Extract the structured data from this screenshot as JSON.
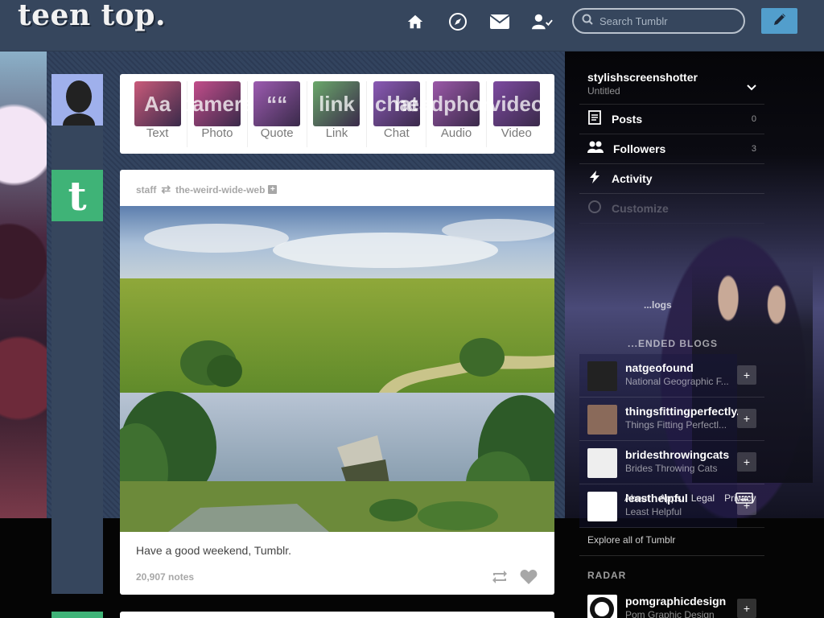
{
  "header": {
    "logo": "teen top.",
    "search_placeholder": "Search Tumblr",
    "nav_icons": [
      "home-icon",
      "compass-icon",
      "mail-icon",
      "account-icon"
    ],
    "compose_icon": "pencil-icon"
  },
  "post_types": [
    {
      "label": "Text",
      "icon": "Aa",
      "color": "#c95a7a"
    },
    {
      "label": "Photo",
      "icon": "camera",
      "color": "#c24d8a"
    },
    {
      "label": "Quote",
      "icon": "““",
      "color": "#9c5bb0"
    },
    {
      "label": "Link",
      "icon": "link",
      "color": "#6aa86a"
    },
    {
      "label": "Chat",
      "icon": "chat",
      "color": "#8a5ab5"
    },
    {
      "label": "Audio",
      "icon": "headphones",
      "color": "#9b58a8"
    },
    {
      "label": "Video",
      "icon": "video",
      "color": "#7d4aa0"
    }
  ],
  "post": {
    "author": "staff",
    "reblogged_from": "the-weird-wide-web",
    "caption": "Have a good weekend, Tumblr.",
    "notes": "20,907 notes"
  },
  "sidebar": {
    "blog_name": "stylishscreenshotter",
    "blog_title": "Untitled",
    "items": [
      {
        "label": "Posts",
        "count": "0",
        "icon": "posts-icon"
      },
      {
        "label": "Followers",
        "count": "3",
        "icon": "followers-icon"
      },
      {
        "label": "Activity",
        "count": "",
        "icon": "activity-icon"
      },
      {
        "label": "Customize",
        "count": "",
        "icon": "customize-icon"
      }
    ],
    "partial_heading_1": "...logs",
    "recommended_heading": "...ENDED BLOGS",
    "recommended": [
      {
        "name": "natgeofound",
        "title": "National Geographic F...",
        "color": "#222222"
      },
      {
        "name": "thingsfittingperfectly...",
        "title": "Things Fitting Perfectl...",
        "color": "#8a6a5a"
      },
      {
        "name": "bridesthrowingcats",
        "title": "Brides Throwing Cats",
        "color": "#eeeeee"
      },
      {
        "name": "leasthelpful",
        "title": "Least Helpful",
        "color": "#ffffff"
      }
    ],
    "footer_links": [
      "About",
      "Apps",
      "Legal",
      "Privacy"
    ],
    "explore": "Explore all of Tumblr",
    "radar_heading": "RADAR",
    "radar": {
      "name": "pomgraphicdesign",
      "title": "Pom Graphic Design"
    }
  }
}
